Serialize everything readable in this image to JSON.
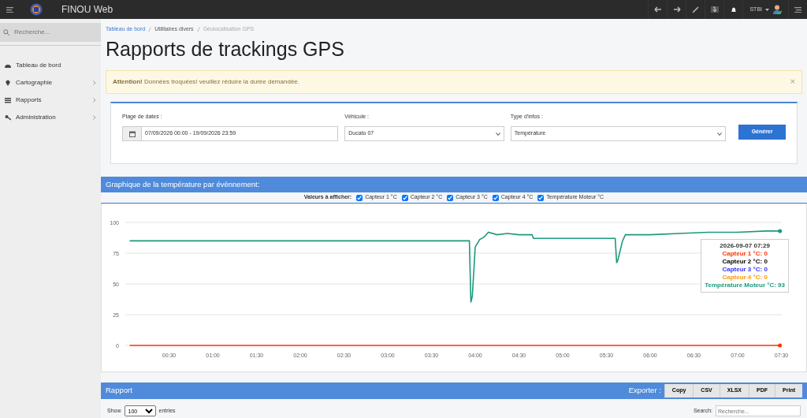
{
  "app": {
    "title": "FINOU Web"
  },
  "topbar": {
    "user": "STBI"
  },
  "search": {
    "placeholder": "Recherche..."
  },
  "sidebar": {
    "items": [
      {
        "label": "Tableau de bord",
        "submenu": false
      },
      {
        "label": "Cartographie",
        "submenu": true
      },
      {
        "label": "Rapports",
        "submenu": true
      },
      {
        "label": "Administration",
        "submenu": true
      }
    ]
  },
  "breadcrumb": [
    "Tableau de bord",
    "Utilitaires divers",
    "Géolocalisation GPS"
  ],
  "page_title": "Rapports de trackings GPS",
  "alert": {
    "text": "**Attention!** Données troquées! veuillez réduire la durée demandée.",
    "close": "×"
  },
  "filters": {
    "date_label": "Plage de dates :",
    "date_value": "07/09/2026 00:00 - 19/09/2026 23:59",
    "vehicle_label": "Véhicule :",
    "vehicle_value": "Ducato 07",
    "type_label": "Type d'infos :",
    "type_value": "Température",
    "button": "Générer"
  },
  "chart_panel": {
    "title": "Graphique de la température par évènnement:",
    "toggles_label": "Valeurs à afficher:",
    "toggles": [
      {
        "checked": true
      },
      {
        "checked": true
      },
      {
        "checked": true
      },
      {
        "checked": true
      },
      {
        "checked": true
      }
    ],
    "chart_data": {
      "type": "line",
      "x": [
        3,
        236,
        237,
        238,
        240,
        243,
        246,
        249,
        255,
        262,
        270,
        279,
        280,
        300,
        320,
        336,
        337,
        338,
        341,
        343,
        360,
        380,
        400,
        420,
        440,
        449
      ],
      "series": [
        {
          "name": "Capteur 1 °C",
          "color": "#ff3300",
          "values": [
            0,
            0,
            0,
            0,
            0,
            0,
            0,
            0,
            0,
            0,
            0,
            0,
            0,
            0,
            0,
            0,
            0,
            0,
            0,
            0,
            0,
            0,
            0,
            0,
            0,
            0
          ]
        },
        {
          "name": "Capteur 2 °C",
          "values": [
            null,
            null,
            null,
            null,
            null,
            null,
            null,
            null,
            null,
            null,
            null,
            null,
            null,
            null,
            null,
            null,
            null,
            null,
            null,
            null,
            null,
            null,
            null,
            null,
            null,
            null
          ]
        },
        {
          "name": "Capteur 3 °C",
          "values": [
            null,
            null,
            null,
            null,
            null,
            null,
            null,
            null,
            null,
            null,
            null,
            null,
            null,
            null,
            null,
            null,
            null,
            null,
            null,
            null,
            null,
            null,
            null,
            null,
            null,
            null
          ]
        },
        {
          "name": "Capteur 4 °C",
          "values": [
            null,
            null,
            null,
            null,
            null,
            null,
            null,
            null,
            null,
            null,
            null,
            null,
            null,
            null,
            null,
            null,
            null,
            null,
            null,
            null,
            null,
            null,
            null,
            null,
            null,
            null
          ]
        },
        {
          "name": "Température Moteur °C",
          "color": "#1a9a7a",
          "values": [
            85,
            85,
            35,
            40,
            80,
            86,
            88,
            92,
            90,
            91,
            90,
            90,
            87,
            87,
            87,
            87,
            67,
            70,
            85,
            90,
            90,
            91,
            92,
            92,
            93,
            93
          ]
        }
      ],
      "grid": true,
      "xlim": [
        0,
        450
      ],
      "ylim": [
        0,
        100
      ],
      "yticks": [
        0,
        25,
        50,
        75,
        100
      ],
      "xticks": [
        {
          "value": 30,
          "label": "00:30"
        },
        {
          "value": 60,
          "label": "01:00"
        },
        {
          "value": 90,
          "label": "01:30"
        },
        {
          "value": 120,
          "label": "02:00"
        },
        {
          "value": 150,
          "label": "02:30"
        },
        {
          "value": 180,
          "label": "03:00"
        },
        {
          "value": 210,
          "label": "03:30"
        },
        {
          "value": 240,
          "label": "04:00"
        },
        {
          "value": 270,
          "label": "04:30"
        },
        {
          "value": 300,
          "label": "05:00"
        },
        {
          "value": 330,
          "label": "05:30"
        },
        {
          "value": 360,
          "label": "06:00"
        },
        {
          "value": 390,
          "label": "06:30"
        },
        {
          "value": 420,
          "label": "07:00"
        },
        {
          "value": 450,
          "label": "07:30"
        }
      ]
    },
    "tooltip": {
      "title": "2026-09-07 07:29",
      "rows": [
        {
          "text": "Capteur 1 °C: 0",
          "color": "#ff3300"
        },
        {
          "text": "Capteur 2 °C: 0",
          "color": "#000000"
        },
        {
          "text": "Capteur 3 °C: 0",
          "color": "#3333ff"
        },
        {
          "text": "Capteur 4 °C: 0",
          "color": "#ff9900"
        },
        {
          "text": "Température Moteur °C: 93",
          "color": "#1a9a7a"
        }
      ]
    }
  },
  "report": {
    "title": "Rapport",
    "export_label": "Exporter :",
    "export_buttons": [
      "Copy",
      "CSV",
      "XLSX",
      "PDF",
      "Print"
    ],
    "show_label": "Show",
    "show_value": "100",
    "entries_label": "entries",
    "search_label": "Search:",
    "search_placeholder": "Recherche..."
  }
}
